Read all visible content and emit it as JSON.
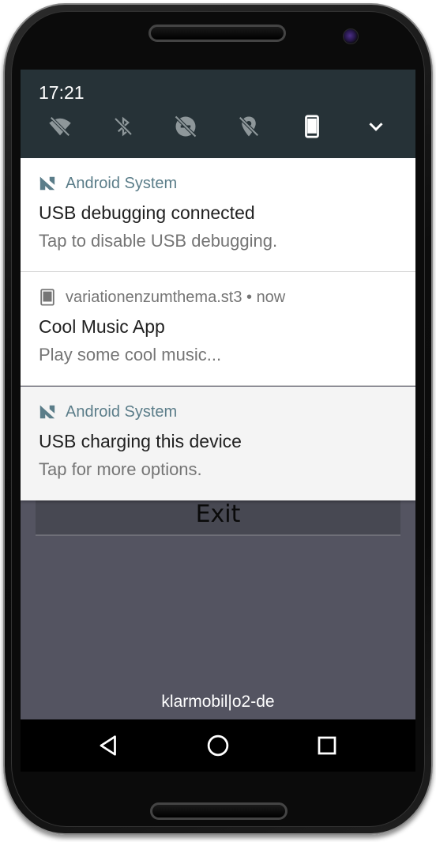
{
  "status_bar": {
    "time": "17:21"
  },
  "quick_settings": {
    "icons": [
      "wifi-off-icon",
      "bluetooth-off-icon",
      "do-not-disturb-off-icon",
      "location-off-icon",
      "portrait-rotation-icon",
      "expand-chevron-icon"
    ]
  },
  "notifications": [
    {
      "app": "Android System",
      "title": "USB debugging connected",
      "text": "Tap to disable USB debugging.",
      "icon": "android-system-icon"
    },
    {
      "app": "variationenzumthema.st3 • now",
      "title": "Cool Music App",
      "text": "Play some cool music...",
      "icon": "tablet-app-icon"
    },
    {
      "app": "Android System",
      "title": "USB charging this device",
      "text": "Tap for more options.",
      "icon": "android-system-icon"
    }
  ],
  "app": {
    "exit_label": "Exit",
    "carrier": "klarmobil|o2-de"
  },
  "colors": {
    "header_bg": "#263237",
    "accent_app_name": "#5b7d89",
    "screen_bg": "#545461"
  }
}
